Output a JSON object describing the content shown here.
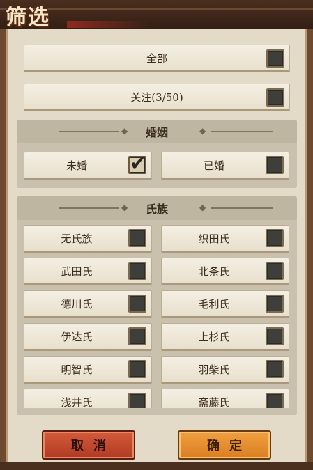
{
  "title": "筛选",
  "top_filters": [
    {
      "label": "全部",
      "checked": false
    },
    {
      "label": "关注(3/50)",
      "checked": false
    }
  ],
  "marriage": {
    "heading": "婚姻",
    "options": [
      {
        "label": "未婚",
        "checked": true
      },
      {
        "label": "已婚",
        "checked": false
      }
    ]
  },
  "clan": {
    "heading": "氏族",
    "options": [
      {
        "label": "无氏族",
        "checked": false
      },
      {
        "label": "织田氏",
        "checked": false
      },
      {
        "label": "武田氏",
        "checked": false
      },
      {
        "label": "北条氏",
        "checked": false
      },
      {
        "label": "德川氏",
        "checked": false
      },
      {
        "label": "毛利氏",
        "checked": false
      },
      {
        "label": "伊达氏",
        "checked": false
      },
      {
        "label": "上杉氏",
        "checked": false
      },
      {
        "label": "明智氏",
        "checked": false
      },
      {
        "label": "羽柴氏",
        "checked": false
      },
      {
        "label": "浅井氏",
        "checked": false
      },
      {
        "label": "斋藤氏",
        "checked": false
      }
    ]
  },
  "actions": {
    "cancel_label": "取消",
    "ok_label": "确定"
  },
  "colors": {
    "panel": "#e3dbc8",
    "cancel": "#c0442c",
    "ok": "#e58f30"
  }
}
